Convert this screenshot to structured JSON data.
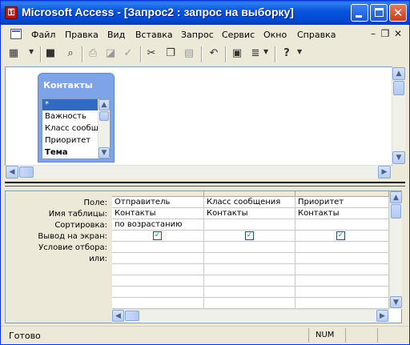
{
  "window": {
    "title": "Microsoft Access - [Запрос2 : запрос на выборку]",
    "app_icon": "access-key-icon",
    "accent_color": "#0a56dd"
  },
  "menu": {
    "items": [
      "Файл",
      "Правка",
      "Вид",
      "Вставка",
      "Запрос",
      "Сервис",
      "Окно",
      "Справка"
    ],
    "mdi_controls": [
      "minimize-icon",
      "restore-icon",
      "close-icon"
    ]
  },
  "toolbar": {
    "buttons": [
      {
        "name": "view-icon",
        "glyph": "▦"
      },
      {
        "name": "save-icon",
        "glyph": "■"
      },
      {
        "name": "search-icon",
        "glyph": "⌕"
      },
      {
        "name": "print-icon",
        "glyph": "⎙"
      },
      {
        "name": "print-preview-icon",
        "glyph": "◪"
      },
      {
        "name": "spelling-icon",
        "glyph": "✓"
      },
      {
        "name": "cut-icon",
        "glyph": "✂"
      },
      {
        "name": "copy-icon",
        "glyph": "❐"
      },
      {
        "name": "paste-icon",
        "glyph": "▤"
      },
      {
        "name": "undo-icon",
        "glyph": "↶"
      },
      {
        "name": "query-type-icon",
        "glyph": "▣"
      },
      {
        "name": "run-icon",
        "glyph": "≣"
      },
      {
        "name": "help-icon",
        "glyph": "?"
      }
    ]
  },
  "table": {
    "title": "Контакты",
    "fields": [
      "*",
      "Важность",
      "Класс сообщения",
      "Приоритет",
      "Тема"
    ],
    "selected_field": "*"
  },
  "grid": {
    "row_labels": [
      "Поле:",
      "Имя таблицы:",
      "Сортировка:",
      "Вывод на экран:",
      "Условие отбора:",
      "или:"
    ],
    "columns": [
      {
        "field": "Отправитель",
        "table": "Контакты",
        "sort": "по возрастанию",
        "show": true
      },
      {
        "field": "Класс сообщения",
        "table": "Контакты",
        "sort": "",
        "show": true
      },
      {
        "field": "Приоритет",
        "table": "Контакты",
        "sort": "",
        "show": true
      }
    ]
  },
  "status": {
    "text": "Готово",
    "num": "NUM"
  }
}
